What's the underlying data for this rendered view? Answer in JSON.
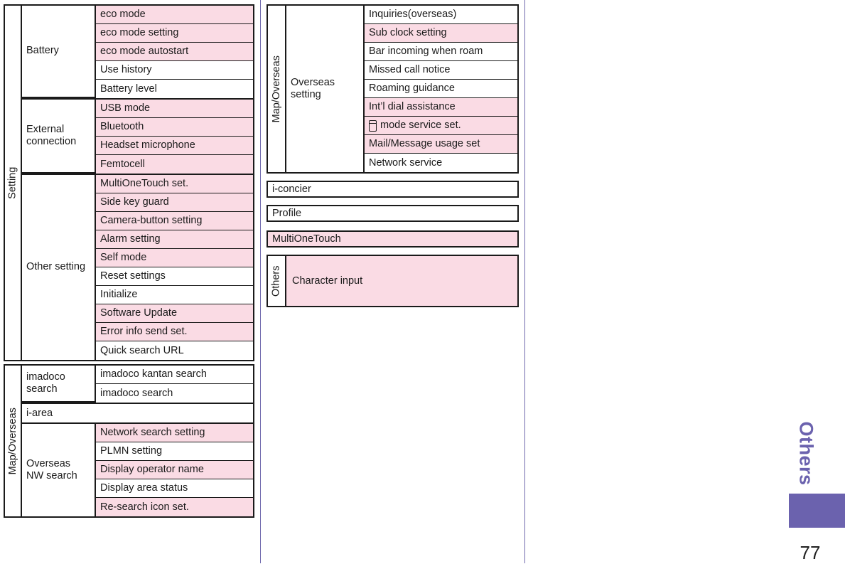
{
  "page": {
    "number": "77",
    "chapter_label": "Others",
    "accent_color": "#6b62ae",
    "highlight_color": "#fadbe4",
    "rule_color": "#6f68ad"
  },
  "setting_table": {
    "chapter": "Setting",
    "groups": [
      {
        "label": "Battery",
        "rows": [
          {
            "text": "eco mode",
            "highlight": true
          },
          {
            "text": "eco mode setting",
            "highlight": true
          },
          {
            "text": "eco mode autostart",
            "highlight": true
          },
          {
            "text": "Use history",
            "highlight": false
          },
          {
            "text": "Battery level",
            "highlight": false
          }
        ]
      },
      {
        "label": "External connection",
        "rows": [
          {
            "text": "USB mode",
            "highlight": true
          },
          {
            "text": "Bluetooth",
            "highlight": true
          },
          {
            "text": "Headset microphone",
            "highlight": true
          },
          {
            "text": "Femtocell",
            "highlight": true
          }
        ]
      },
      {
        "label": "Other setting",
        "rows": [
          {
            "text": "MultiOneTouch set.",
            "highlight": true
          },
          {
            "text": "Side key guard",
            "highlight": true
          },
          {
            "text": "Camera-button setting",
            "highlight": true
          },
          {
            "text": "Alarm setting",
            "highlight": true
          },
          {
            "text": "Self mode",
            "highlight": true
          },
          {
            "text": "Reset settings",
            "highlight": false
          },
          {
            "text": "Initialize",
            "highlight": false
          },
          {
            "text": "Software Update",
            "highlight": true
          },
          {
            "text": "Error info send set.",
            "highlight": true
          },
          {
            "text": "Quick search URL",
            "highlight": false
          }
        ]
      }
    ]
  },
  "map_table": {
    "chapter": "Map/Overseas",
    "groups": [
      {
        "label": "imadoco search",
        "rows": [
          {
            "text": "imadoco kantan search",
            "highlight": false
          },
          {
            "text": "imadoco search",
            "highlight": false
          }
        ]
      }
    ],
    "full_row": {
      "text": "i-area",
      "highlight": false
    },
    "groups2": [
      {
        "label": "Overseas NW search",
        "rows": [
          {
            "text": "Network search setting",
            "highlight": true
          },
          {
            "text": "PLMN setting",
            "highlight": false
          },
          {
            "text": "Display operator name",
            "highlight": true
          },
          {
            "text": "Display area status",
            "highlight": false
          },
          {
            "text": "Re-search icon set.",
            "highlight": true
          }
        ]
      }
    ]
  },
  "overseas_table": {
    "chapter": "Map/Overseas",
    "group_label": "Overseas setting",
    "rows": [
      {
        "text": "Inquiries(overseas)",
        "highlight": false,
        "icon": false
      },
      {
        "text": "Sub clock setting",
        "highlight": true,
        "icon": false
      },
      {
        "text": "Bar incoming when roam",
        "highlight": false,
        "icon": false
      },
      {
        "text": "Missed call notice",
        "highlight": false,
        "icon": false
      },
      {
        "text": "Roaming guidance",
        "highlight": false,
        "icon": false
      },
      {
        "text": "Int’l dial assistance",
        "highlight": true,
        "icon": false
      },
      {
        "text": "mode service set.",
        "highlight": true,
        "icon": true
      },
      {
        "text": "Mail/Message usage set",
        "highlight": true,
        "icon": false
      },
      {
        "text": "Network service",
        "highlight": false,
        "icon": false
      }
    ]
  },
  "solo_rows": {
    "iconcier": "i-concier",
    "profile": "Profile",
    "multionetouch": "MultiOneTouch"
  },
  "others_table": {
    "chapter": "Others",
    "row": "Character input"
  }
}
